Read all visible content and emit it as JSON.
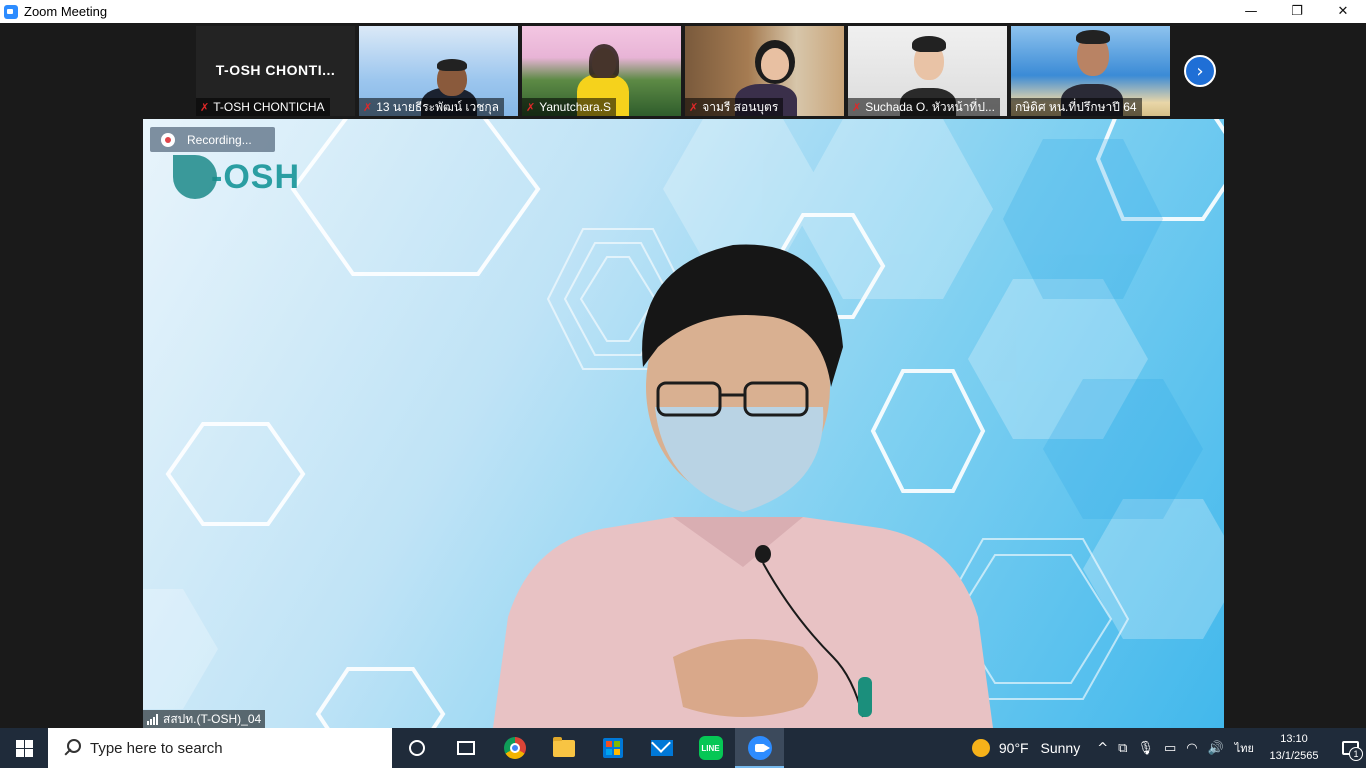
{
  "window": {
    "title": "Zoom Meeting",
    "minimize": "—",
    "restore": "❐",
    "close": "✕"
  },
  "gallery": {
    "first_tile": {
      "big_name": "T-OSH  CHONTI...",
      "label": "T-OSH CHONTICHA"
    },
    "participants": [
      {
        "label": "13 นายธีระพัฒน์ เวชกุล",
        "muted": true
      },
      {
        "label": "Yanutchara.S",
        "muted": true
      },
      {
        "label": "จามรี สอนบุตร",
        "muted": true
      },
      {
        "label": "Suchada O. หัวหน้าที่ป...",
        "muted": true
      },
      {
        "label": "กษิดิศ  หน.ที่ปรึกษาปี 64",
        "muted": false
      }
    ],
    "next_icon": "›"
  },
  "main_video": {
    "recording_label": "Recording...",
    "logo_text": "-OSH",
    "speaker_label": "สสปท.(T-OSH)_04"
  },
  "taskbar": {
    "search_placeholder": "Type here to search",
    "apps": [
      "cortana",
      "task-view",
      "chrome",
      "file-explorer",
      "microsoft-store",
      "mail",
      "line",
      "zoom"
    ],
    "line_label": "LINE",
    "weather_temp": "90°F",
    "weather_desc": "Sunny",
    "tray_chevron": "^",
    "language": "ไทย",
    "time": "13:10",
    "date": "13/1/2565",
    "notification_count": "1"
  }
}
